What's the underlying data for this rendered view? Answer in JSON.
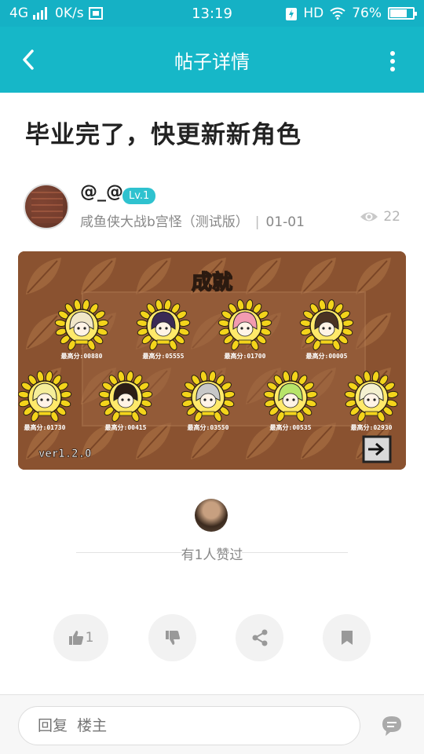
{
  "status_bar": {
    "network": "4G",
    "speed": "0K/s",
    "time": "13:19",
    "hd": "HD",
    "battery": "76%",
    "battery_level": 0.76
  },
  "app_bar": {
    "title": "帖子详情"
  },
  "post": {
    "title": "毕业完了，快更新新角色",
    "author": {
      "name": "@_@",
      "level": "Lv.1",
      "group": "咸鱼侠大战b宫怪（测试版）",
      "separator": "|",
      "date": "01-01"
    },
    "views": "22",
    "image": {
      "heading": "成就",
      "version": "ver1.2.0",
      "scores_row1": [
        "最高分:00880",
        "最高分:05555",
        "最高分:01700",
        "最高分:00005"
      ],
      "scores_row2": [
        "最高分:01730",
        "最高分:00415",
        "最高分:03550",
        "最高分:00535",
        "最高分:02930"
      ]
    }
  },
  "likes": {
    "text": "有1人赞过"
  },
  "actions": {
    "like_count": "1"
  },
  "reply": {
    "placeholder": "回复  楼主"
  },
  "colors": {
    "accent": "#16b7c8",
    "badge": "#2fc2cf"
  }
}
